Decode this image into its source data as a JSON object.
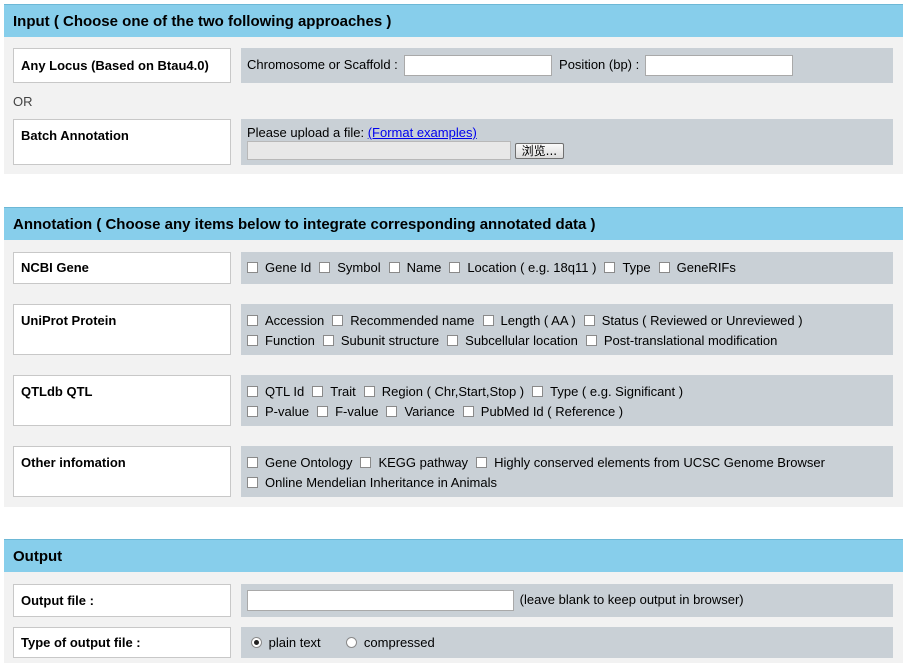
{
  "input": {
    "header": "Input ( Choose one of the two following approaches )",
    "locus_label": "Any Locus (Based on Btau4.0)",
    "chrom_label": "Chromosome or Scaffold :",
    "chrom_value": "",
    "pos_label": "Position (bp) :",
    "pos_value": "",
    "or_text": "OR",
    "batch_label": "Batch Annotation",
    "upload_text": "Please upload a file:",
    "format_link": "(Format examples)",
    "browse_button": "浏览..."
  },
  "annotation": {
    "header": "Annotation ( Choose any items below to integrate corresponding annotated data )",
    "groups": [
      {
        "label": "NCBI Gene",
        "rows": [
          [
            "Gene Id",
            "Symbol",
            "Name",
            "Location ( e.g. 18q11 )",
            "Type",
            "GeneRIFs"
          ]
        ]
      },
      {
        "label": "UniProt Protein",
        "rows": [
          [
            "Accession",
            "Recommended name",
            "Length ( AA )",
            "Status ( Reviewed or Unreviewed )"
          ],
          [
            "Function",
            "Subunit structure",
            "Subcellular location",
            "Post-translational modification"
          ]
        ]
      },
      {
        "label": "QTLdb QTL",
        "rows": [
          [
            "QTL Id",
            "Trait",
            "Region ( Chr,Start,Stop )",
            "Type ( e.g. Significant )"
          ],
          [
            "P-value",
            "F-value",
            "Variance",
            "PubMed Id ( Reference )"
          ]
        ]
      },
      {
        "label": "Other infomation",
        "rows": [
          [
            "Gene Ontology",
            "KEGG pathway",
            "Highly conserved elements from UCSC Genome Browser"
          ],
          [
            "Online Mendelian Inheritance in Animals"
          ]
        ]
      }
    ]
  },
  "output": {
    "header": "Output",
    "file_label": "Output file :",
    "file_value": "",
    "file_hint": "(leave blank to keep output in browser)",
    "type_label": "Type of output file :",
    "type_options": [
      "plain text",
      "compressed"
    ],
    "type_selected": "plain text"
  }
}
